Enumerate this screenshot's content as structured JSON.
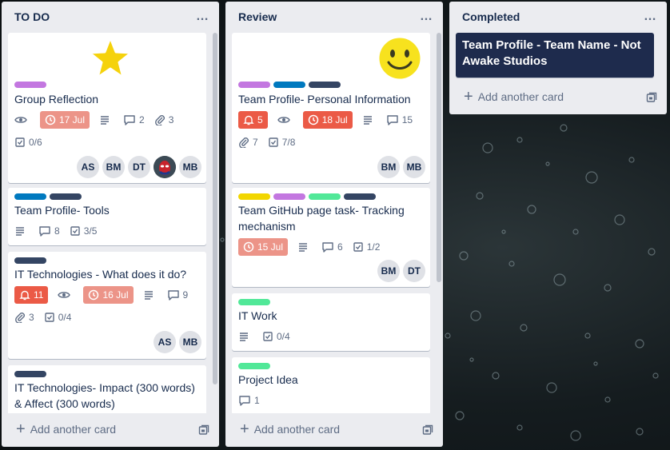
{
  "lists": [
    {
      "title": "TO DO",
      "add_label": "Add another card",
      "cards": [
        {
          "title": "Group Reflection",
          "labels": [
            "#c377e0",
            "",
            ""
          ],
          "due": "17 Jul",
          "comments": "2",
          "attachments": "3",
          "checklist": "0/6",
          "members": [
            "AS",
            "BM",
            "DT",
            "",
            "MB"
          ]
        },
        {
          "title": "Team Profile- Tools",
          "labels": [
            "#0079bf",
            "#344563"
          ],
          "comments": "8",
          "checklist": "3/5"
        },
        {
          "title": "IT Technologies - What does it do?",
          "labels": [
            "#344563"
          ],
          "notifications": "11",
          "due": "16 Jul",
          "comments": "9",
          "attachments": "3",
          "checklist": "0/4",
          "members": [
            "AS",
            "MB"
          ]
        },
        {
          "title_line1": "IT Technologies- Impact (300 words)",
          "title_line2": "& Affect (300 words)",
          "labels": [
            "#344563"
          ]
        }
      ]
    },
    {
      "title": "Review",
      "add_label": "Add another card",
      "cards": [
        {
          "title": "Team Profile- Personal Information",
          "labels": [
            "#c377e0",
            "#0079bf",
            "#344563"
          ],
          "notifications": "5",
          "due": "18 Jul",
          "comments": "15",
          "attachments": "7",
          "checklist": "7/8",
          "members": [
            "BM",
            "MB"
          ]
        },
        {
          "title_line1": "Team GitHub page task- Tracking",
          "title_line2": "mechanism",
          "labels": [
            "#f2d600",
            "#c377e0",
            "#51e898",
            "#344563"
          ],
          "due": "15 Jul",
          "comments": "6",
          "checklist": "1/2",
          "members": [
            "BM",
            "DT"
          ]
        },
        {
          "title": "IT Work",
          "labels": [
            "#51e898"
          ],
          "checklist": "0/4"
        },
        {
          "title": "Project Idea",
          "labels": [
            "#51e898"
          ],
          "comments": "1"
        }
      ]
    },
    {
      "title": "Completed",
      "add_label": "Add another card",
      "cards": [
        {
          "title_line1": "Team Profile - Team Name - Not",
          "title_line2": "Awake Studios"
        }
      ]
    }
  ],
  "icons": {
    "menu": "…",
    "star": "star-sticker",
    "smiley": "smiley-sticker"
  },
  "colors": {
    "list_bg": "#ebecf0",
    "completed_card_bg": "#1e2b4d",
    "due_soon": "#ec9488",
    "overdue": "#eb5a46"
  }
}
